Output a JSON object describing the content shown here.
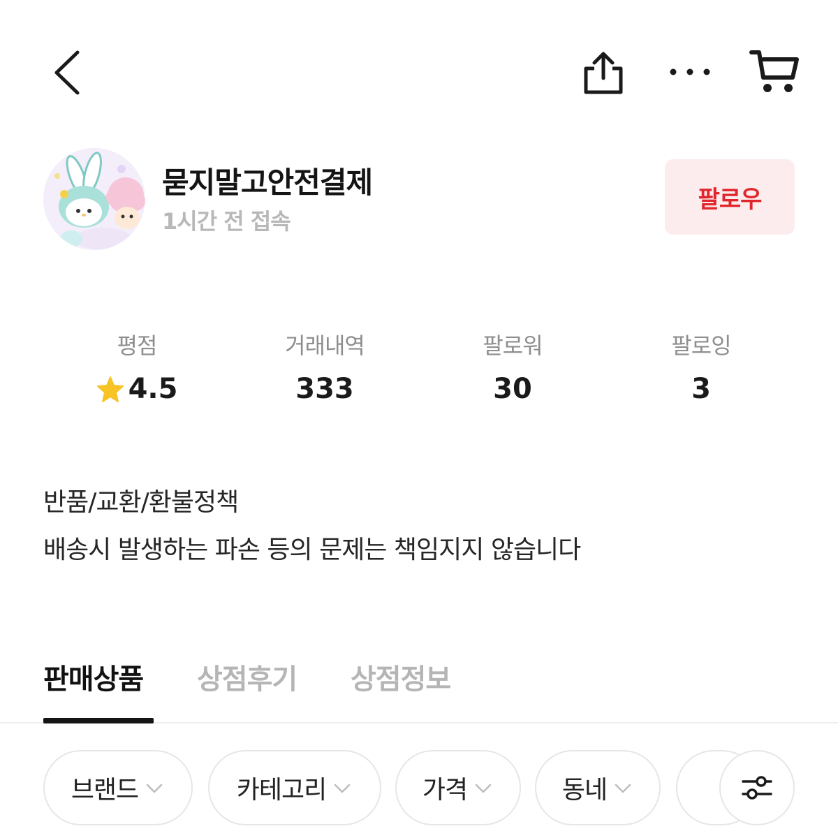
{
  "header": {
    "back_icon": "chevron-left-icon",
    "share_icon": "share-icon",
    "more_icon": "more-horizontal-icon",
    "cart_icon": "cart-icon"
  },
  "profile": {
    "shop_name": "묻지말고안전결제",
    "last_seen": "1시간 전 접속",
    "follow_label": "팔로우"
  },
  "stats": [
    {
      "label": "평점",
      "value": "4.5",
      "icon": "star-icon"
    },
    {
      "label": "거래내역",
      "value": "333"
    },
    {
      "label": "팔로워",
      "value": "30"
    },
    {
      "label": "팔로잉",
      "value": "3"
    }
  ],
  "policy": {
    "title": "반품/교환/환불정책",
    "text": "배송시 발생하는 파손 등의 문제는 책임지지 않습니다"
  },
  "tabs": [
    {
      "label": "판매상품",
      "active": true
    },
    {
      "label": "상점후기",
      "active": false
    },
    {
      "label": "상점정보",
      "active": false
    }
  ],
  "filters": [
    {
      "label": "브랜드"
    },
    {
      "label": "카테고리"
    },
    {
      "label": "가격"
    },
    {
      "label": "동네"
    }
  ],
  "colors": {
    "accent": "#e0252b",
    "follow_bg": "#fdeced",
    "star": "#f7c325",
    "muted": "#b5b5b5"
  }
}
